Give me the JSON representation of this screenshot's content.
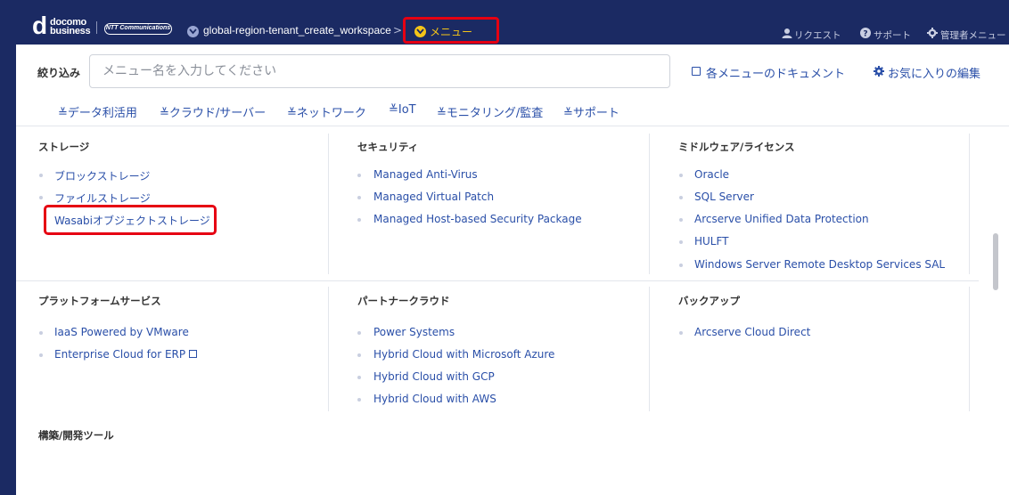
{
  "header": {
    "logo_top": "docomo",
    "logo_bottom": "business",
    "ntt_logo": "NTT Communications",
    "breadcrumb": "global-region-tenant_create_workspace",
    "breadcrumb_chevron": ">",
    "menu_label": "メニュー",
    "request": "リクエスト",
    "support": "サポート",
    "admin_menu": "管理者メニュー"
  },
  "filter": {
    "label": "絞り込み",
    "placeholder": "メニュー名を入力してください"
  },
  "links": {
    "docs": "各メニューのドキュメント",
    "favorites": "お気に入りの編集"
  },
  "category_tabs": [
    "≚データ利活用",
    "≚クラウド/サーバー",
    "≚ネットワーク",
    "≚IoT",
    "≚モニタリング/監査",
    "≚サポート"
  ],
  "sections": {
    "storage": {
      "title": "ストレージ",
      "items": [
        "ブロックストレージ",
        "ファイルストレージ",
        "Wasabiオブジェクトストレージ"
      ]
    },
    "security": {
      "title": "セキュリティ",
      "items": [
        "Managed Anti-Virus",
        "Managed Virtual Patch",
        "Managed Host-based Security Package"
      ]
    },
    "middleware": {
      "title": "ミドルウェア/ライセンス",
      "items": [
        "Oracle",
        "SQL Server",
        "Arcserve Unified Data Protection",
        "HULFT",
        "Windows Server Remote Desktop Services SAL"
      ]
    },
    "platform": {
      "title": "プラットフォームサービス",
      "items": [
        "IaaS Powered by VMware",
        "Enterprise Cloud for ERP"
      ]
    },
    "partner": {
      "title": "パートナークラウド",
      "items": [
        "Power Systems",
        "Hybrid Cloud with Microsoft Azure",
        "Hybrid Cloud with GCP",
        "Hybrid Cloud with AWS"
      ]
    },
    "backup": {
      "title": "バックアップ",
      "items": [
        "Arcserve Cloud Direct"
      ]
    },
    "devtools": {
      "title": "構築/開発ツール"
    }
  }
}
